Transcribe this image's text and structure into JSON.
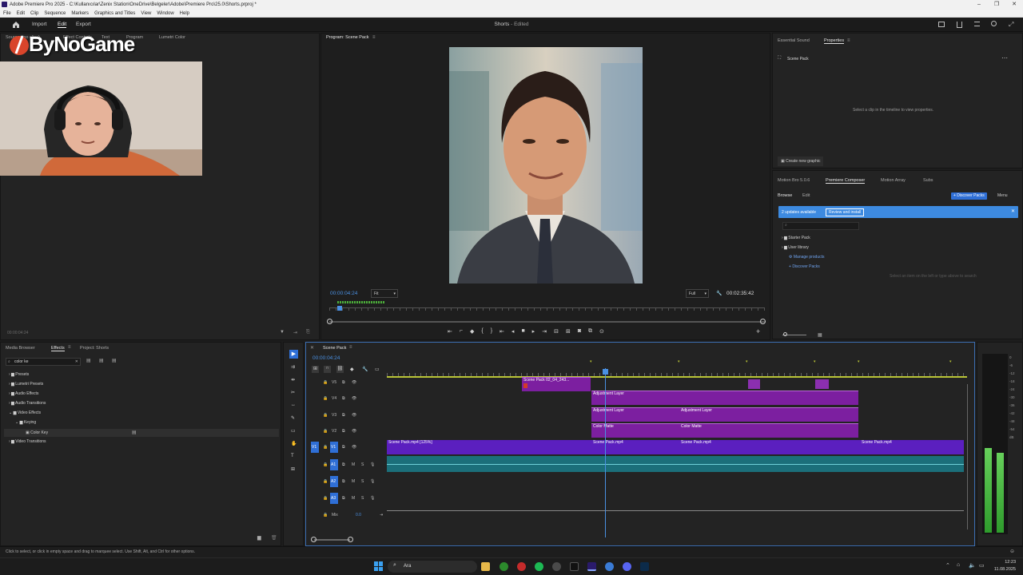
{
  "window": {
    "title": "Adobe Premiere Pro 2025 - C:\\Kullanıcılar\\Zenix Station\\OneDrive\\Belgeler\\Adobe\\Premiere Pro\\25.0\\Shorts.prproj *",
    "controls": [
      "–",
      "❐",
      "✕"
    ]
  },
  "menubar": [
    "File",
    "Edit",
    "Clip",
    "Sequence",
    "Markers",
    "Graphics and Titles",
    "View",
    "Window",
    "Help"
  ],
  "appbar": {
    "import": "Import",
    "edit": "Edit",
    "export": "Export",
    "project_title": "Shorts",
    "project_state": "- Edited"
  },
  "source_panel": {
    "tabs": [
      "Source: (no clips)",
      "Effect Controls",
      "Text",
      "Program",
      "Lumetri Color"
    ],
    "timecode": "00:00:04:24",
    "logo_text": "ByNoGame"
  },
  "program_monitor": {
    "tab": "Program: Scene Pack",
    "timecode": "00:00:04:24",
    "fit": "Fit",
    "quality": "Full",
    "duration": "00:02:35:42"
  },
  "properties_panel": {
    "tabs": [
      "Essential Sound",
      "Properties"
    ],
    "item": "Scene Pack",
    "message": "Select a clip in the timeline to view properties.",
    "create_graphic": "Create new graphic"
  },
  "composer_panel": {
    "tabs": [
      "Motion Bro 5.0.6",
      "Premiere Composer",
      "Motion Array",
      "Subs"
    ],
    "subtabs": [
      "Browse",
      "Edit"
    ],
    "discover_btn": "+ Discover Packs",
    "menu": "Menu",
    "banner_text": "2 updates available",
    "banner_btn": "Review and install",
    "tree": [
      "Starter Pack",
      "User library",
      "Manage products",
      "Discover Packs"
    ],
    "hint": "Select an item on the left or type above to search"
  },
  "effects_panel": {
    "tabs": [
      "Media Browser",
      "Effects",
      "Project: Shorts"
    ],
    "search_value": "color ke",
    "tree": [
      "Presets",
      "Lumetri Presets",
      "Audio Effects",
      "Audio Transitions",
      "Video Effects",
      "Keying",
      "Color Key",
      "Video Transitions"
    ]
  },
  "timeline": {
    "tab": "Scene Pack",
    "timecode": "00:00:04:24",
    "video_tracks": [
      "V5",
      "V4",
      "V3",
      "V2",
      "V1"
    ],
    "audio_tracks": [
      "A1",
      "A2",
      "A3"
    ],
    "mix_label": "Mix",
    "mix_value": "0.0",
    "clips": {
      "v5_clip": "Scene Pack 02_04_243...",
      "v4_adj": "Adjustment Layer",
      "v3_adj1": "Adjustment Layer",
      "v3_adj2": "Adjustment Layer",
      "v2_matte1": "Color Matte",
      "v2_matte2": "Color Matte",
      "v1_a": "Scene Pack.mp4 [125%]",
      "v1_b": "Scene Pack.mp4",
      "v1_c": "Scene Pack.mp4",
      "v1_d": "Scene Pack.mp4"
    }
  },
  "meter_scale": [
    "0",
    "-6",
    "-12",
    "-18",
    "-24",
    "-30",
    "-36",
    "-42",
    "-48",
    "-54",
    "dB"
  ],
  "status_bar": "Click to select, or click in empty space and drag to marquee select. Use Shift, Alt, and Ctrl for other options.",
  "taskbar": {
    "search": "Ara",
    "time": "12:23",
    "date": "11.08.2025"
  },
  "colors": {
    "accent": "#4a90e2",
    "clip_purple": "#7c1fa0",
    "clip_violet": "#5b1fbf",
    "audio_teal": "#1b6f7a",
    "meter_green": "#4cbf45"
  }
}
